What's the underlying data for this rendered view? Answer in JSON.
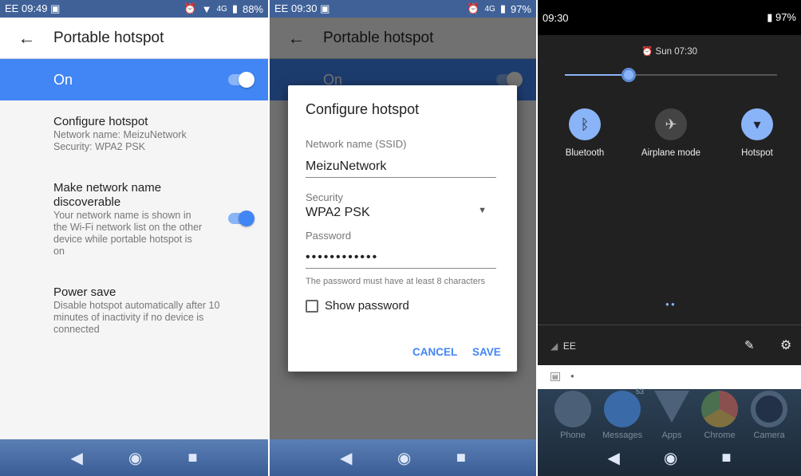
{
  "panel1": {
    "status": {
      "carrier": "EE",
      "time": "09:49",
      "network": "4G",
      "battery": "88%"
    },
    "header": {
      "title": "Portable hotspot"
    },
    "master": {
      "label": "On",
      "on": true
    },
    "items": [
      {
        "title": "Configure hotspot",
        "sub": "Network name: MeizuNetwork\nSecurity: WPA2 PSK"
      },
      {
        "title": "Make network name discoverable",
        "sub": "Your network name is shown in the Wi-Fi network list on the other device while portable hotspot is on",
        "on": true
      },
      {
        "title": "Power save",
        "sub": "Disable hotspot automatically after 10 minutes of inactivity if no device is connected"
      }
    ]
  },
  "panel2": {
    "status": {
      "carrier": "EE",
      "time": "09:30",
      "network": "4G",
      "battery": "97%"
    },
    "header": {
      "title": "Portable hotspot"
    },
    "master": {
      "label": "On"
    },
    "dialog": {
      "title": "Configure hotspot",
      "ssid_label": "Network name (SSID)",
      "ssid": "MeizuNetwork",
      "security_label": "Security",
      "security": "WPA2 PSK",
      "password_label": "Password",
      "password": "••••••••••••",
      "hint": "The password must have at least 8 characters",
      "show_password": "Show password",
      "cancel": "CANCEL",
      "save": "SAVE"
    }
  },
  "panel3": {
    "status": {
      "time": "09:30",
      "battery": "97%"
    },
    "alarm": "Sun 07:30",
    "brightness": 0.3,
    "tiles": [
      {
        "label": "Bluetooth",
        "active": true
      },
      {
        "label": "Airplane mode",
        "active": false
      },
      {
        "label": "Hotspot",
        "active": true
      }
    ],
    "carrier": "EE",
    "apps": [
      {
        "label": "Phone"
      },
      {
        "label": "Messages",
        "badge": "53"
      },
      {
        "label": "Apps"
      },
      {
        "label": "Chrome"
      },
      {
        "label": "Camera"
      }
    ]
  },
  "colors": {
    "accent": "#4285f4",
    "statusbar": "#3f6198"
  }
}
